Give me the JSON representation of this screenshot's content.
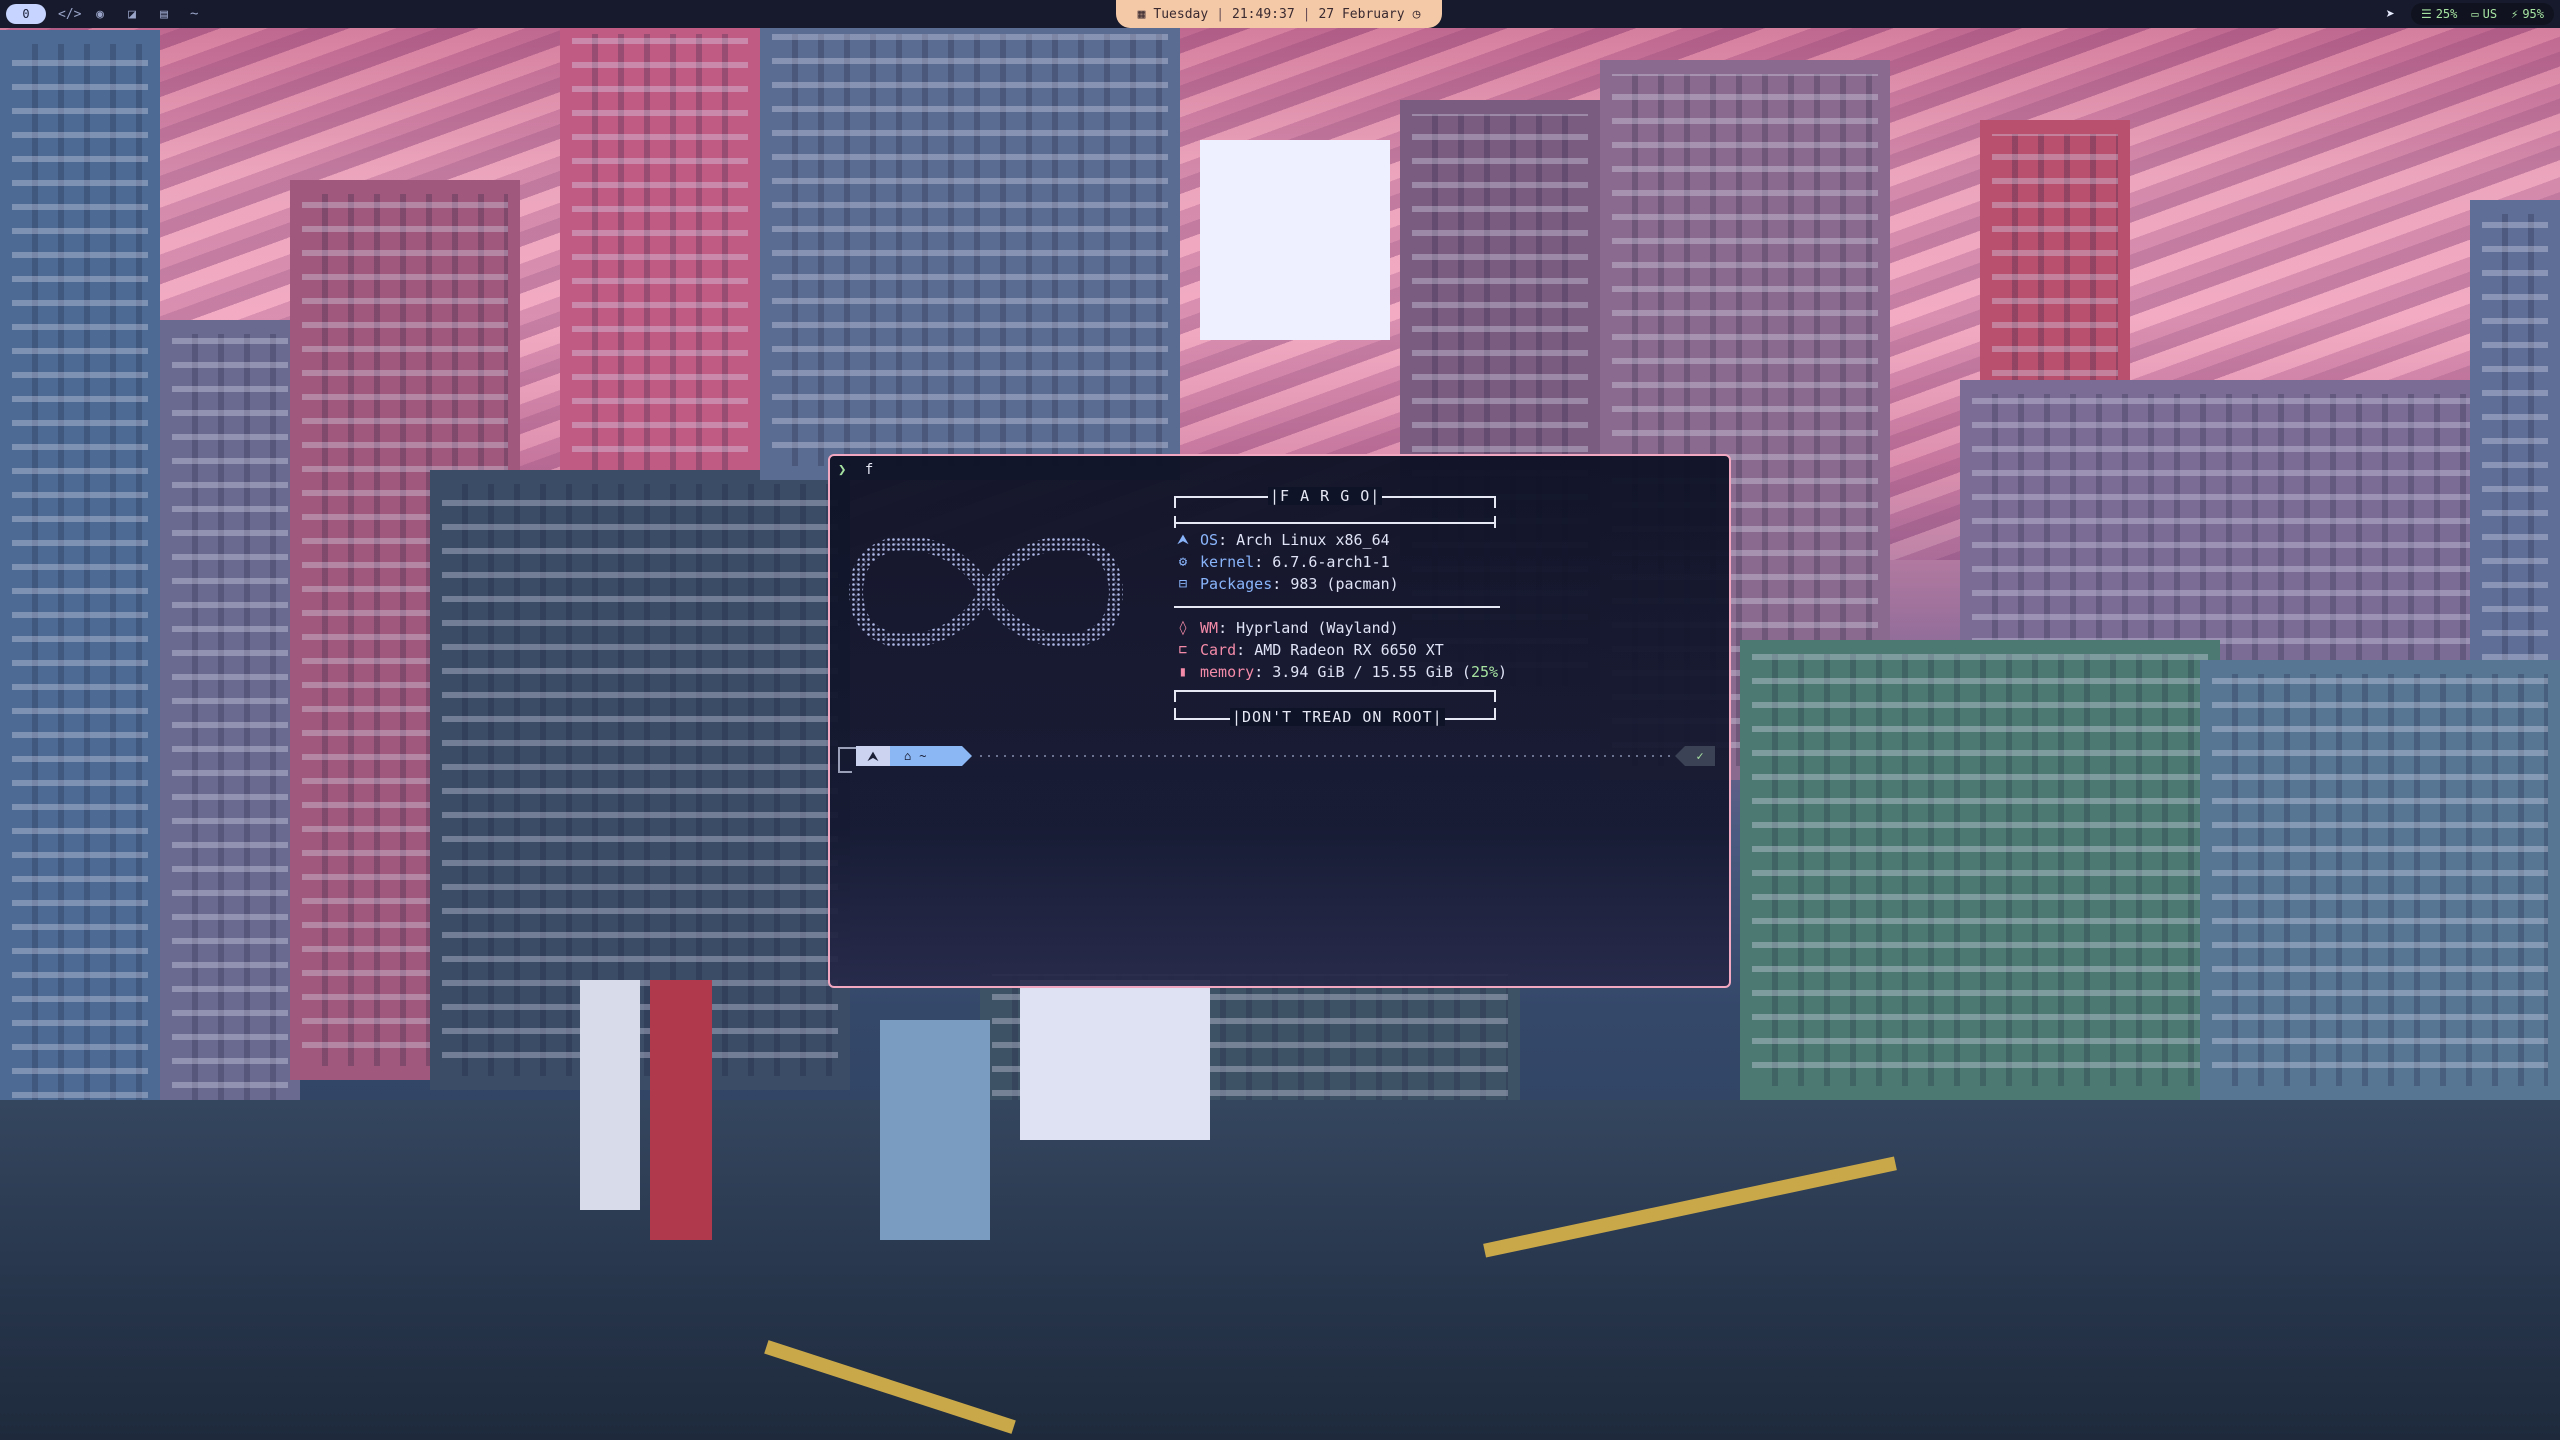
{
  "topbar": {
    "workspace_label": "0",
    "left_icons": [
      "code-icon",
      "firefox-icon",
      "files-icon",
      "document-icon"
    ],
    "title": "~",
    "clock": {
      "day": "Tuesday",
      "time": "21:49:37",
      "date": "27 February"
    },
    "tray": {
      "cpu": "25%",
      "keyboard_layout": "US",
      "battery": "95%"
    }
  },
  "terminal": {
    "command": "f",
    "fetch": {
      "header": "|F A R G O|",
      "footer": "|DON'T TREAD ON ROOT|",
      "rows_top": [
        {
          "key": "OS",
          "value": "Arch Linux x86_64",
          "icon": "arch-icon",
          "glyph": "⮝"
        },
        {
          "key": "kernel",
          "value": "6.7.6-arch1-1",
          "icon": "gear-icon",
          "glyph": "⚙"
        },
        {
          "key": "Packages",
          "value": "983 (pacman)",
          "icon": "package-icon",
          "glyph": "⊟"
        }
      ],
      "rows_bottom": [
        {
          "key": "WM",
          "value": "Hyprland (Wayland)",
          "icon": "droplet-icon",
          "glyph": "◊"
        },
        {
          "key": "Card",
          "value": "AMD Radeon RX 6650 XT",
          "icon": "gpu-icon",
          "glyph": "⊏"
        },
        {
          "key": "memory",
          "value_main": "3.94 GiB / 15.55 GiB (",
          "value_pct": "25%",
          "value_end": ")",
          "icon": "memory-icon",
          "glyph": "▮"
        }
      ]
    },
    "prompt": {
      "os_glyph": "⮝",
      "dir_glyph": "⌂",
      "dir_label": "~",
      "ok_glyph": "✓"
    }
  },
  "colors": {
    "accent_border": "#f2a8c0",
    "clock_pill": "#f4c9a8",
    "key_blue": "#89b4fa",
    "key_pink": "#f38ba8",
    "success_green": "#a6e3a1"
  }
}
